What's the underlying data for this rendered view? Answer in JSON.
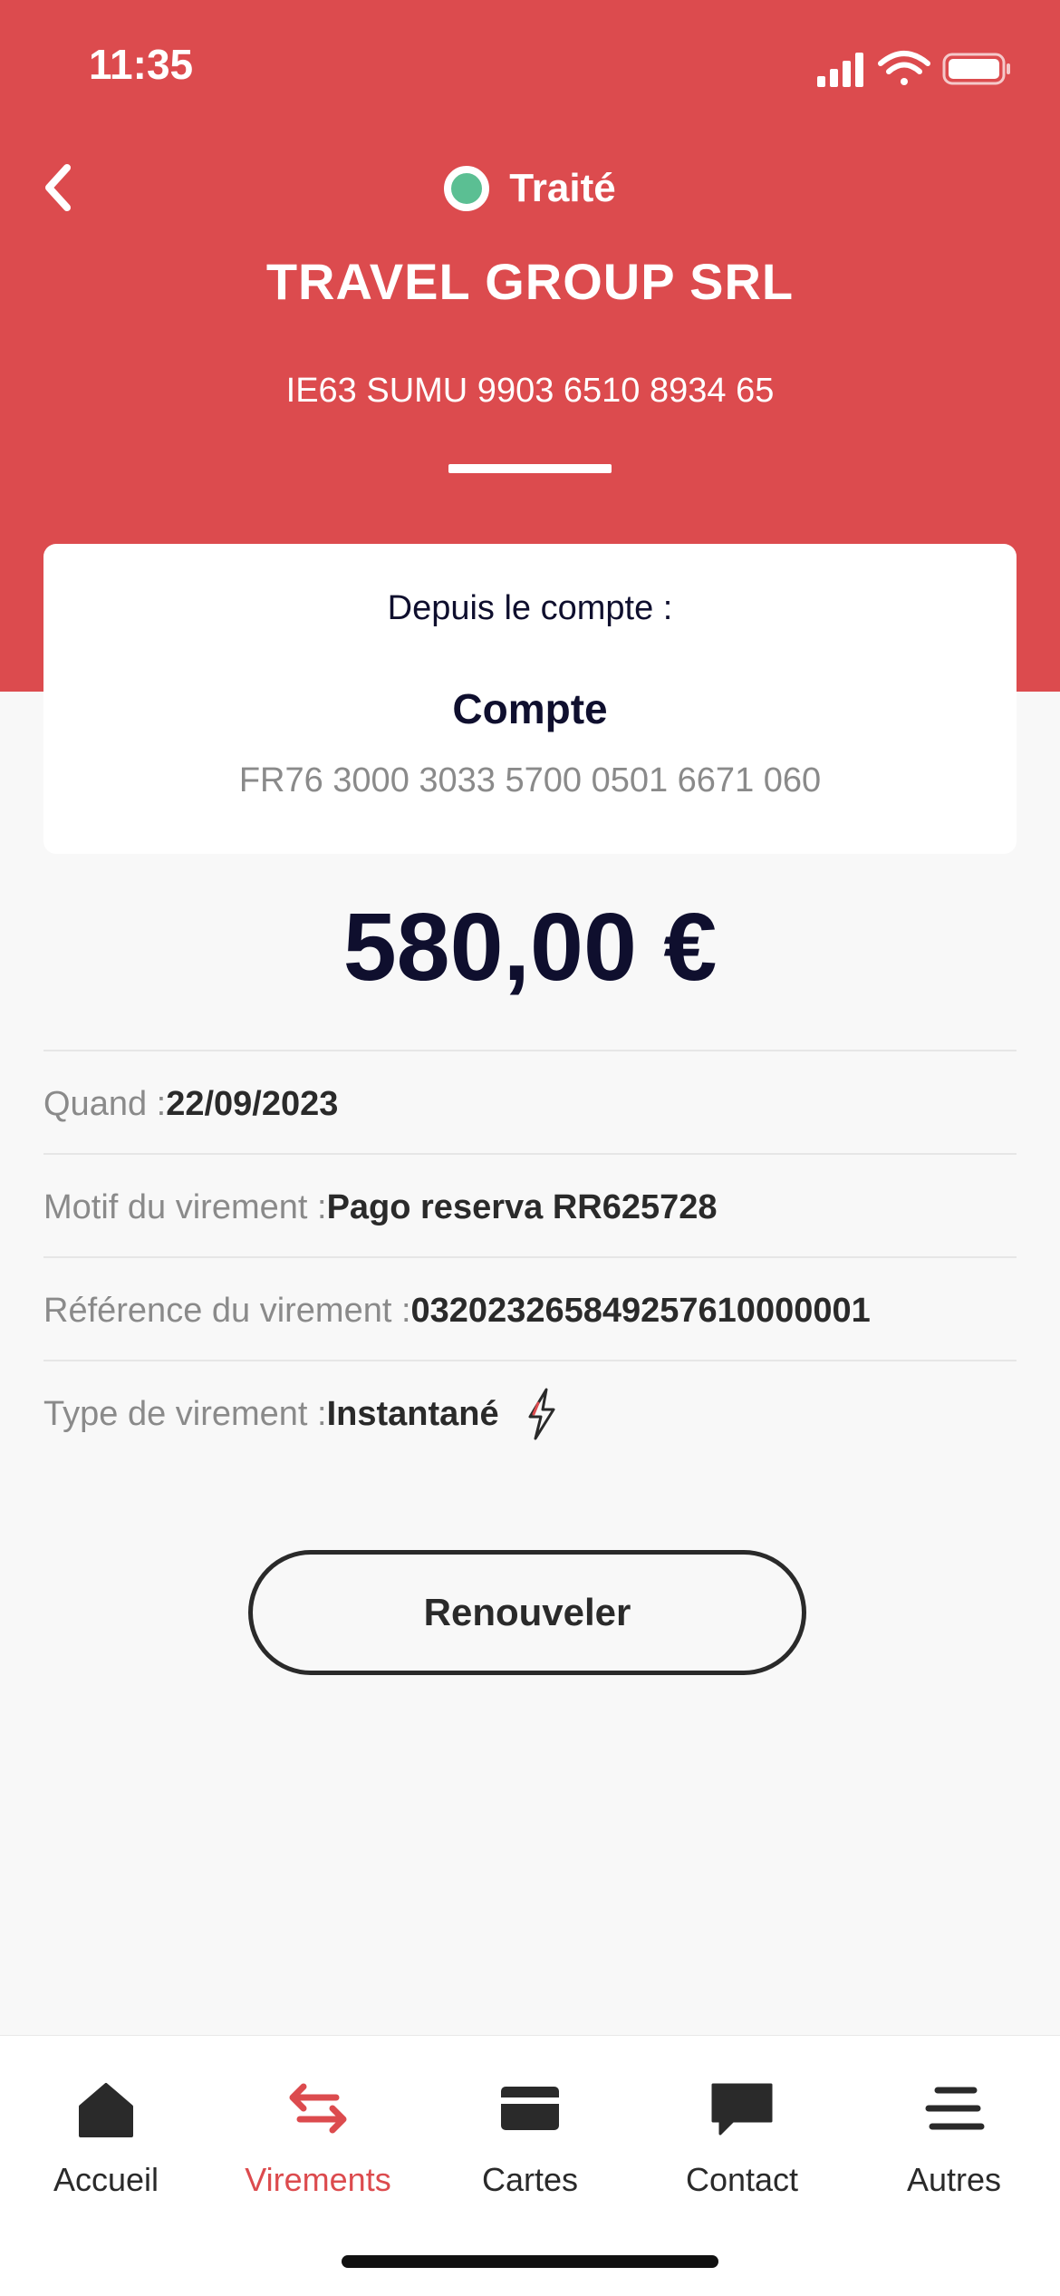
{
  "status_bar": {
    "time": "11:35"
  },
  "header": {
    "status": {
      "label": "Traité",
      "color": "#5bbf93"
    },
    "beneficiary_name": "TRAVEL GROUP SRL",
    "beneficiary_iban": "IE63 SUMU 9903 6510 8934 65",
    "background_color": "#dc4b4e"
  },
  "account_card": {
    "label": "Depuis le compte :",
    "account_name": "Compte",
    "account_iban": "FR76 3000 3033 5700 0501 6671 060"
  },
  "amount": "580,00 €",
  "details": [
    {
      "label": "Quand : ",
      "value": "22/09/2023"
    },
    {
      "label": "Motif du virement : ",
      "value": "Pago reserva RR625728"
    },
    {
      "label": "Référence du virement : ",
      "value": "032023265849257610000001"
    },
    {
      "label": "Type de virement : ",
      "value": "Instantané",
      "icon": "lightning-icon"
    }
  ],
  "renew_button": {
    "label": "Renouveler"
  },
  "tabbar": {
    "active_color": "#dc4b4e",
    "items": [
      {
        "label": "Accueil",
        "icon": "home-icon",
        "active": false
      },
      {
        "label": "Virements",
        "icon": "transfer-arrows-icon",
        "active": true
      },
      {
        "label": "Cartes",
        "icon": "card-icon",
        "active": false
      },
      {
        "label": "Contact",
        "icon": "chat-icon",
        "active": false
      },
      {
        "label": "Autres",
        "icon": "menu-icon",
        "active": false
      }
    ]
  }
}
